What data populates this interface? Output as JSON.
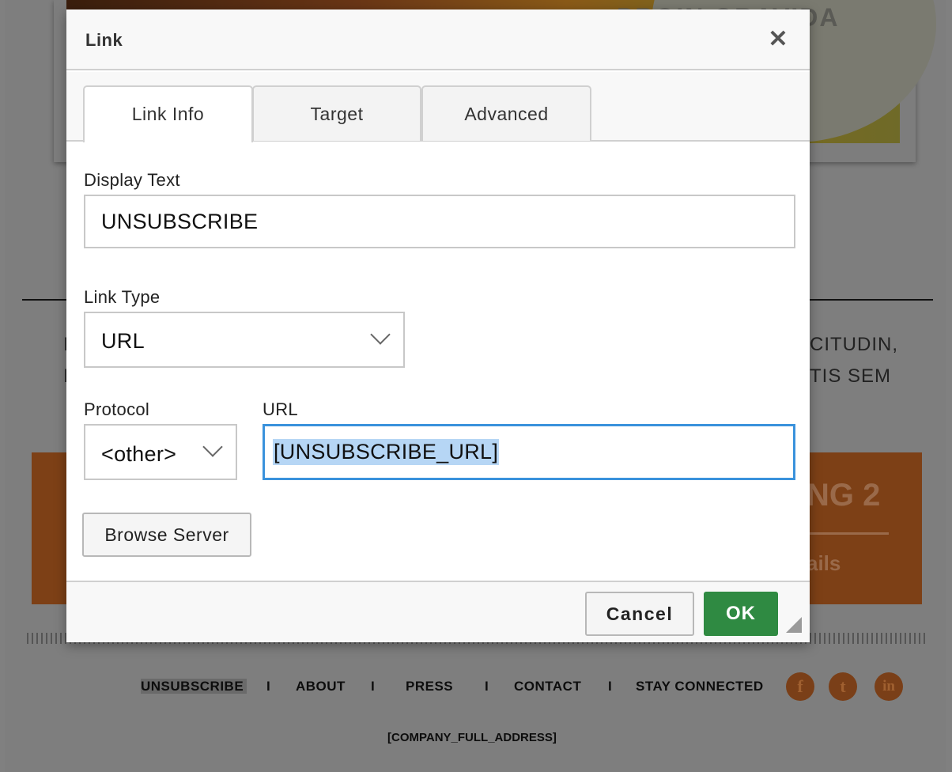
{
  "background": {
    "photo_title": "PROIN GRAVIDA",
    "text_right_1": "CITUDIN,",
    "text_right_2": "TIS SEM",
    "text_left_1": "I",
    "text_left_2": "I",
    "orange_heading": "NG 2",
    "orange_link": "ails",
    "footer_links": {
      "unsubscribe": "UNSUBSCRIBE",
      "about": "ABOUT",
      "press": "PRESS",
      "contact": "CONTACT",
      "stay_connected": "STAY CONNECTED",
      "separator": "I"
    },
    "social_icons": [
      "facebook-icon",
      "twitter-icon",
      "linkedin-icon"
    ],
    "social_glyphs": {
      "facebook": "f",
      "twitter": "t",
      "linkedin": "in"
    },
    "company_address": "[COMPANY_FULL_ADDRESS]"
  },
  "dialog": {
    "title": "Link",
    "close_glyph": "✕",
    "tabs": [
      {
        "label": "Link Info",
        "active": true
      },
      {
        "label": "Target",
        "active": false
      },
      {
        "label": "Advanced",
        "active": false
      }
    ],
    "display_text": {
      "label": "Display Text",
      "value": "UNSUBSCRIBE"
    },
    "link_type": {
      "label": "Link Type",
      "value": "URL"
    },
    "protocol": {
      "label": "Protocol",
      "value": "<other>"
    },
    "url": {
      "label": "URL",
      "value": "[UNSUBSCRIBE_URL]",
      "selected": true
    },
    "browse_button": "Browse Server",
    "cancel_button": "Cancel",
    "ok_button": "OK",
    "colors": {
      "ok": "#2f8a42",
      "focus": "#3a92dc",
      "selection": "#b6d6f5"
    }
  }
}
